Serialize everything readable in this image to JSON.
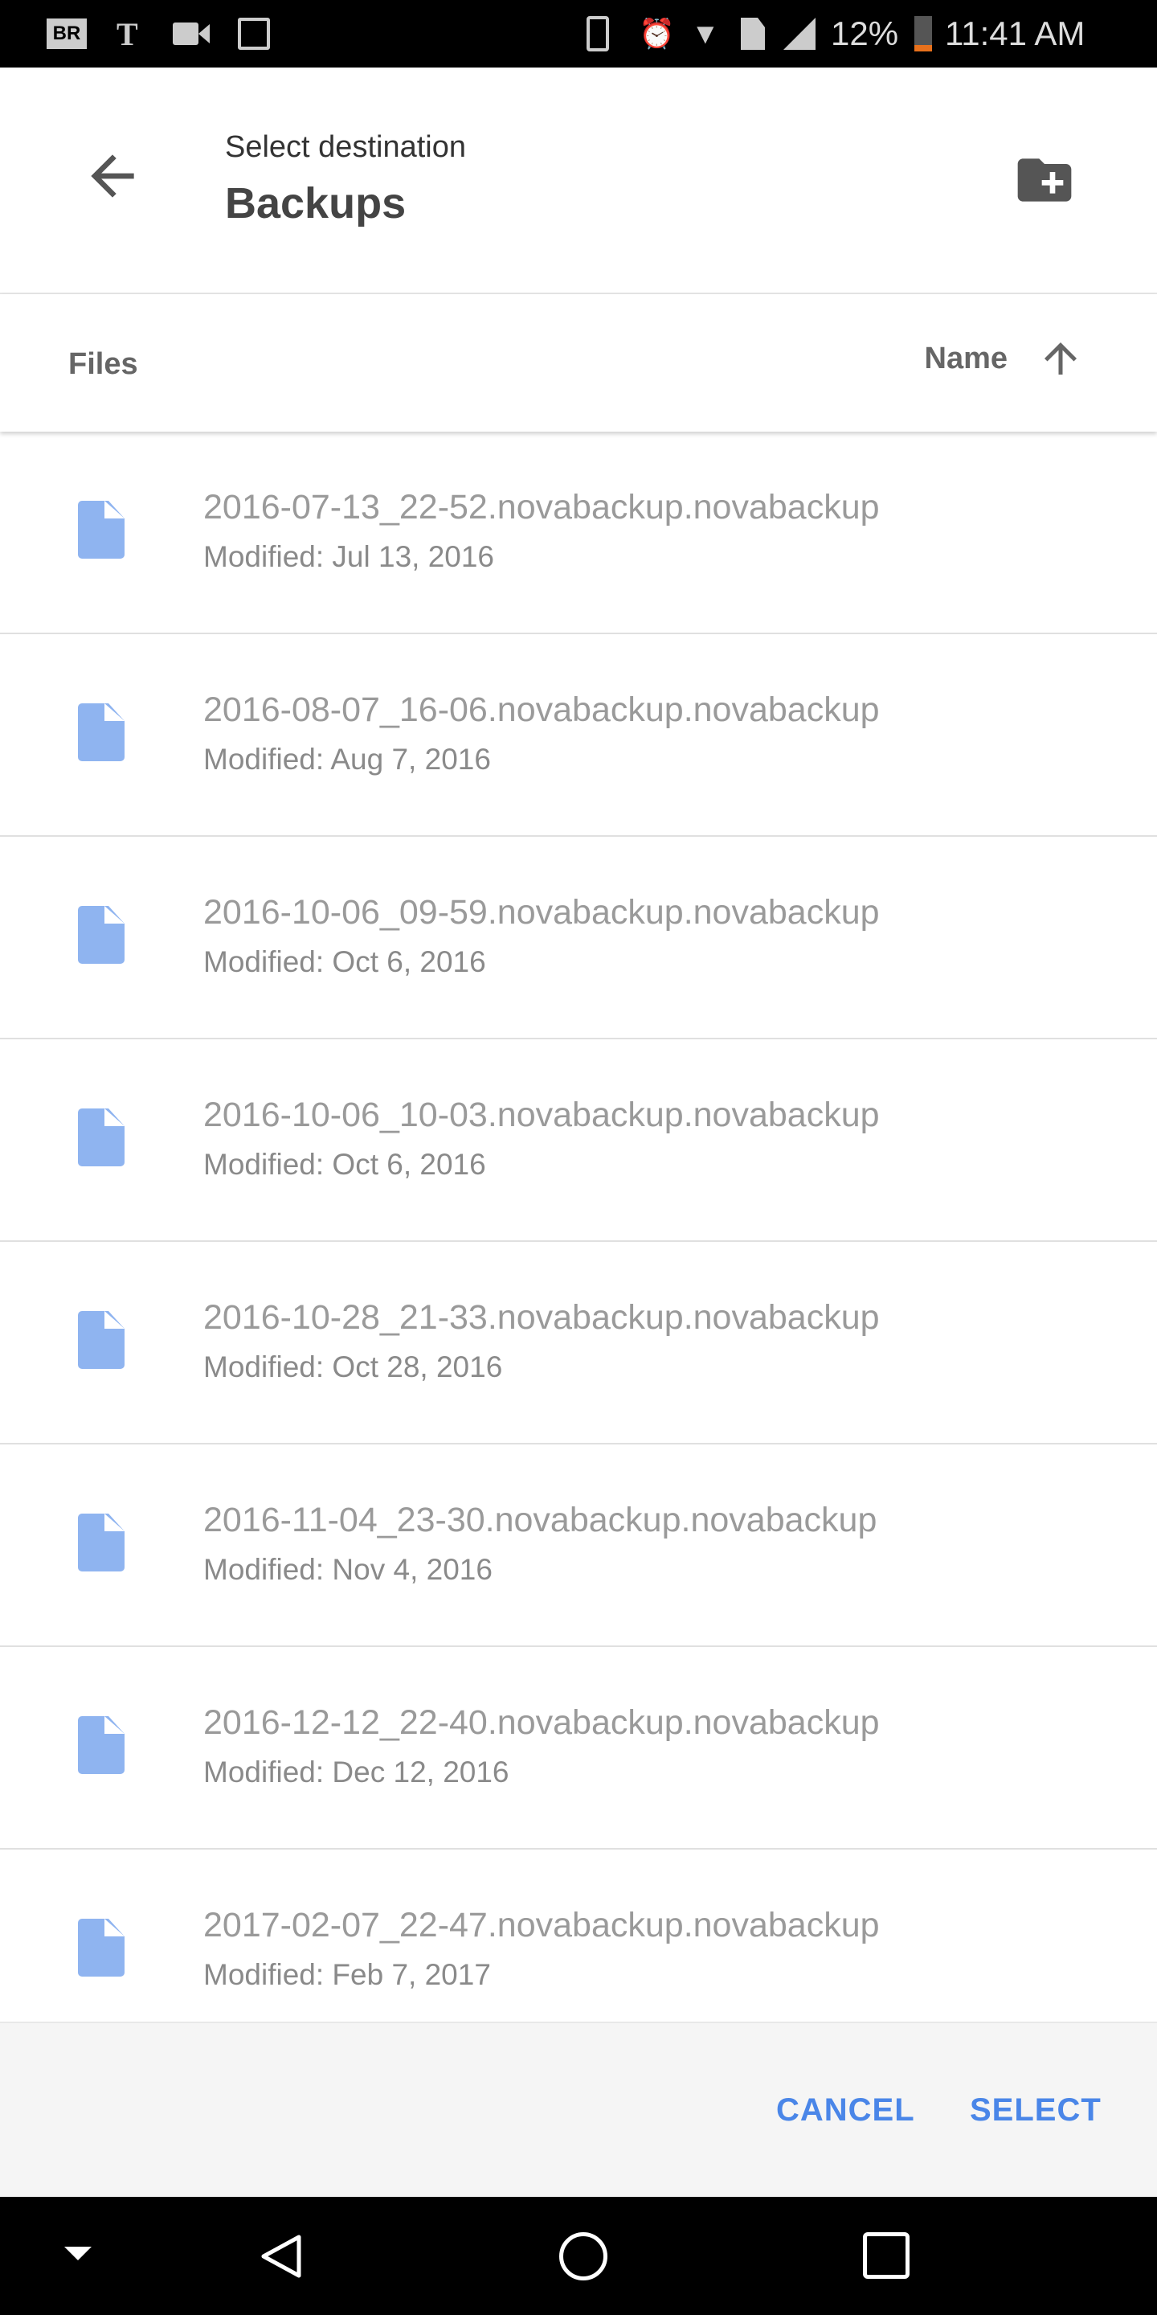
{
  "status_bar": {
    "battery": "12%",
    "time": "11:41 AM",
    "battery_color": "#e8711c",
    "icons": [
      "bleacher-report-icon",
      "nyt-icon",
      "video-icon",
      "image-icon",
      "vibrate-icon",
      "alarm-icon",
      "wifi-icon",
      "no-sim-icon",
      "signal-icon",
      "battery-icon"
    ]
  },
  "header": {
    "subtitle": "Select destination",
    "title": "Backups",
    "new_folder_icon": "create-new-folder-icon"
  },
  "sort_bar": {
    "section": "Files",
    "sort_label": "Name",
    "sort_direction": "ascending"
  },
  "files": [
    {
      "name": "2016-07-13_22-52.novabackup.novabackup",
      "modified": "Modified: Jul 13, 2016"
    },
    {
      "name": "2016-08-07_16-06.novabackup.novabackup",
      "modified": "Modified: Aug 7, 2016"
    },
    {
      "name": "2016-10-06_09-59.novabackup.novabackup",
      "modified": "Modified: Oct 6, 2016"
    },
    {
      "name": "2016-10-06_10-03.novabackup.novabackup",
      "modified": "Modified: Oct 6, 2016"
    },
    {
      "name": "2016-10-28_21-33.novabackup.novabackup",
      "modified": "Modified: Oct 28, 2016"
    },
    {
      "name": "2016-11-04_23-30.novabackup.novabackup",
      "modified": "Modified: Nov 4, 2016"
    },
    {
      "name": "2016-12-12_22-40.novabackup.novabackup",
      "modified": "Modified: Dec 12, 2016"
    },
    {
      "name": "2017-02-07_22-47.novabackup.novabackup",
      "modified": "Modified: Feb 7, 2017"
    }
  ],
  "footer": {
    "cancel": "CANCEL",
    "select": "SELECT",
    "accent": "#4a86e8"
  },
  "colors": {
    "file_icon": "#8fb4f0"
  }
}
